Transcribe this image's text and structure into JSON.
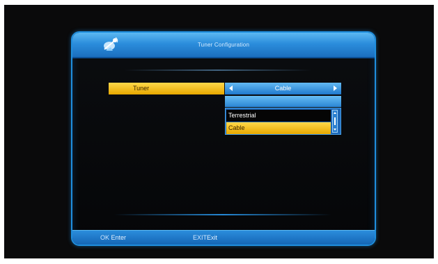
{
  "osd": {
    "title": "Tuner Configuration",
    "logo_icon": "satellite-dish-icon"
  },
  "tuner": {
    "label": "Tuner",
    "value": "Cable",
    "left_arrow_icon": "left-arrow-icon",
    "right_arrow_icon": "right-arrow-icon"
  },
  "dropdown": {
    "options": [
      "Terrestrial",
      "Cable"
    ],
    "selected": "Cable"
  },
  "footer": {
    "hints": [
      {
        "key": "OK",
        "action": "Enter"
      },
      {
        "key": "EXIT",
        "action": "Exit"
      }
    ]
  },
  "colors": {
    "accent_blue": "#1f8ede",
    "highlight_yellow": "#ffd84a",
    "background": "#0a0a0b"
  }
}
